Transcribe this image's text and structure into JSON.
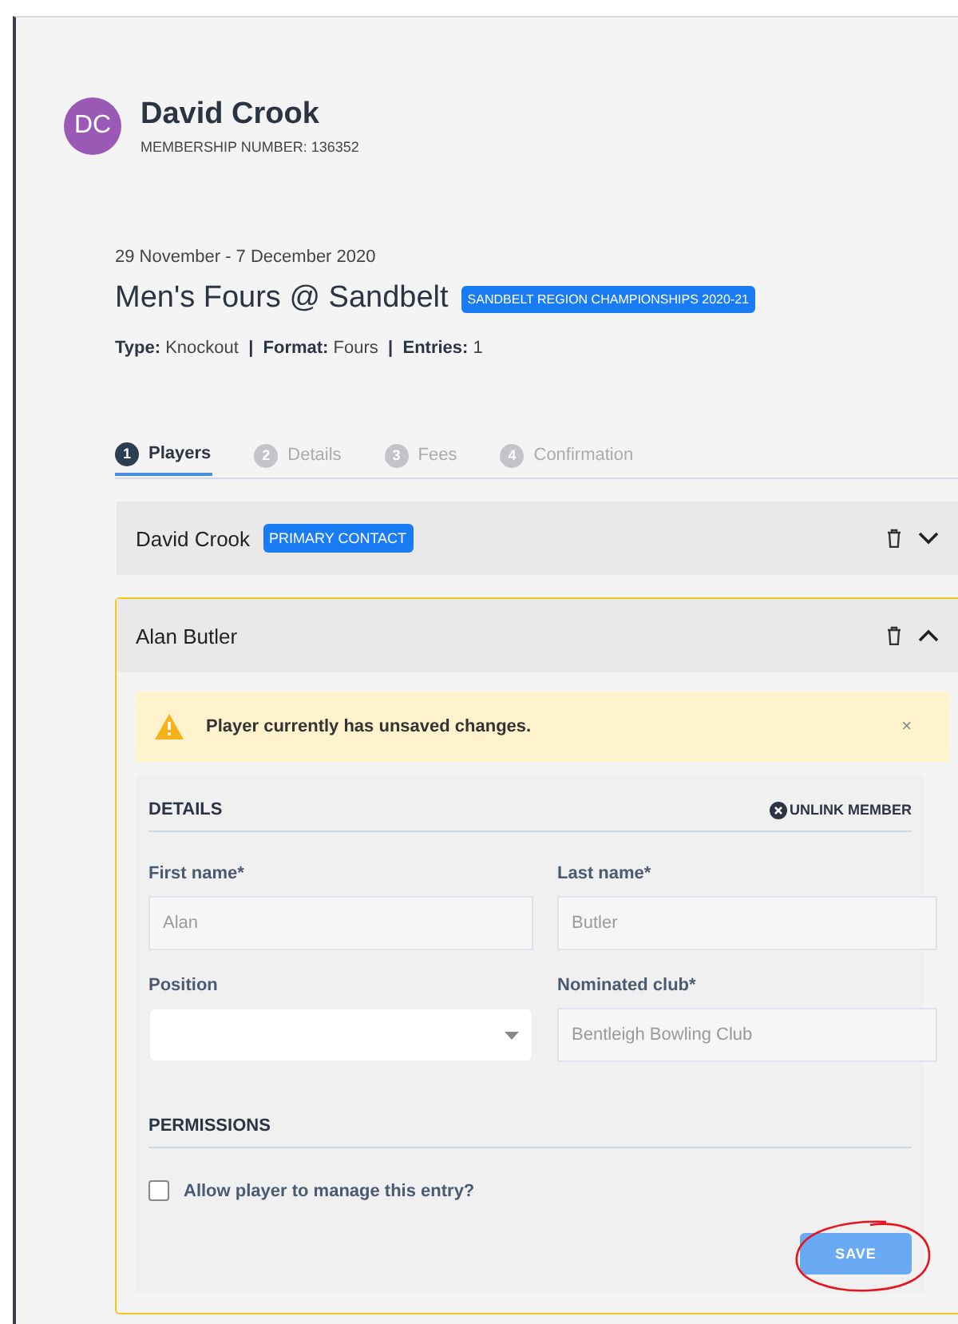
{
  "profile": {
    "initials": "DC",
    "name": "David Crook",
    "membership": "MEMBERSHIP NUMBER: 136352"
  },
  "event": {
    "dates": "29 November - 7 December 2020",
    "title": "Men's Fours @ Sandbelt",
    "badge": "SANDBELT REGION CHAMPIONSHIPS 2020-21",
    "meta": "**Type:** Knockout  **|**  **Format:** Fours  **|**  **Entries:** 1"
  },
  "steps": [
    {
      "number": "1",
      "label": "Players",
      "selected": true
    },
    {
      "number": "2",
      "label": "Details",
      "selected": false
    },
    {
      "number": "3",
      "label": "Fees",
      "selected": false
    },
    {
      "number": "4",
      "label": "Confirmation",
      "selected": false
    }
  ],
  "players": [
    {
      "name": "David Crook",
      "badge": "PRIMARY CONTACT",
      "highlighted": false,
      "expanded": false
    },
    {
      "name": "Alan Butler",
      "highlighted": true,
      "expanded": true,
      "alert": {
        "text": "Player currently has unsaved changes.",
        "close": "×"
      },
      "details": {
        "title": "DETAILS",
        "unlink": "UNLINK MEMBER",
        "fields": [
          {
            "kind": "text",
            "label": "First name*",
            "value": "Alan",
            "disabled": true
          },
          {
            "kind": "text",
            "label": "Last name*",
            "value": "Butler",
            "disabled": true
          },
          {
            "kind": "select",
            "label": "Position",
            "disabled": false
          },
          {
            "kind": "text",
            "label": "Nominated club*",
            "value": "Bentleigh Bowling Club",
            "disabled": true
          }
        ]
      },
      "permissions": {
        "title": "PERMISSIONS",
        "checkbox": {
          "label": "Allow player to manage this entry?",
          "checked": false
        }
      },
      "save": {
        "label": "SAVE",
        "circled": true
      }
    }
  ]
}
